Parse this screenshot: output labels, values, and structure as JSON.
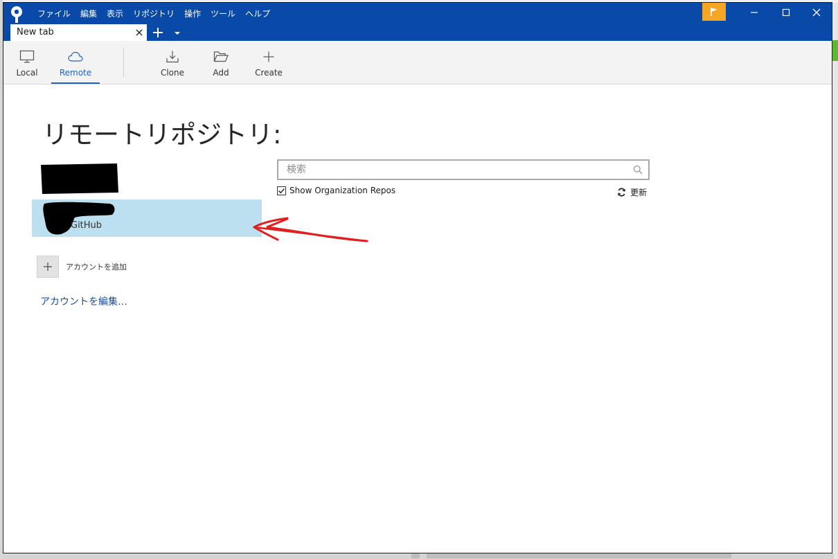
{
  "menu": {
    "items": [
      "ファイル",
      "編集",
      "表示",
      "リポジトリ",
      "操作",
      "ツール",
      "ヘルプ"
    ]
  },
  "tabs": {
    "active_label": "New tab"
  },
  "toolbar": {
    "local_label": "Local",
    "remote_label": "Remote",
    "clone_label": "Clone",
    "add_label": "Add",
    "create_label": "Create"
  },
  "main": {
    "title": "リモートリポジトリ:",
    "account": {
      "provider": "GitHub"
    },
    "add_account_label": "アカウントを追加",
    "edit_accounts_label": "アカウントを編集…"
  },
  "search": {
    "placeholder": "検索",
    "value": "",
    "show_org_repos_label": "Show Organization Repos",
    "show_org_repos_checked": true,
    "refresh_label": "更新"
  },
  "colors": {
    "titlebar": "#0949a8",
    "accent": "#1e63c4",
    "selected_row": "#bde0f0",
    "flag": "#f5a623",
    "annotation": "#e02020"
  },
  "icons": {
    "app": "sourcetree-logo-icon",
    "flag": "flag-icon",
    "local": "monitor-icon",
    "remote": "cloud-icon",
    "clone": "download-icon",
    "add": "folder-open-icon",
    "create": "plus-icon",
    "search": "search-icon",
    "refresh": "refresh-icon"
  }
}
